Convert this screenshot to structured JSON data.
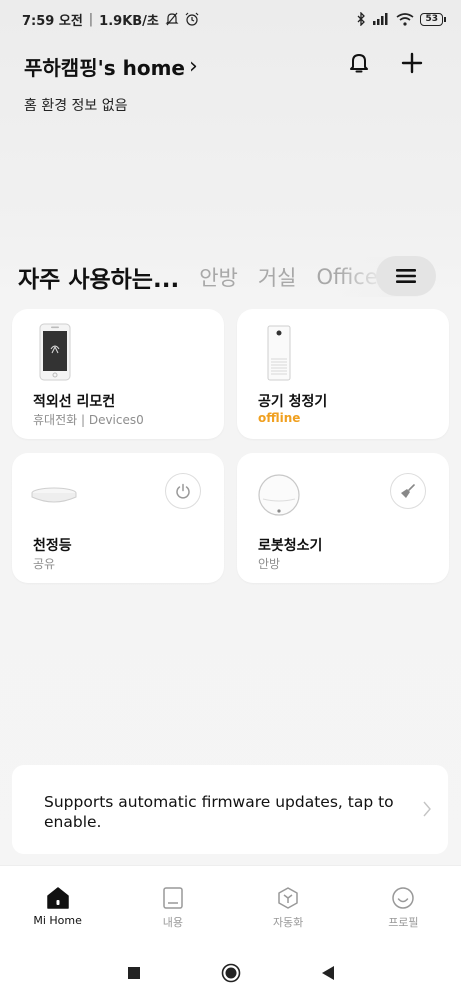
{
  "status": {
    "time": "7:59 오전",
    "network_speed": "1.9KB/초",
    "battery": "53"
  },
  "header": {
    "home_name": "푸하캠핑's home",
    "chevron": "›",
    "subtitle": "홈 환경 정보 없음"
  },
  "tabs": [
    {
      "label": "자주 사용하는...",
      "active": true
    },
    {
      "label": "안방",
      "active": false
    },
    {
      "label": "거실",
      "active": false
    },
    {
      "label": "Office",
      "active": false
    }
  ],
  "devices": [
    {
      "name": "적외선 리모컨",
      "sub": "휴대전화 | Devices0",
      "icon": "phone-remote-icon"
    },
    {
      "name": "공기 청정기",
      "sub": "offline",
      "icon": "air-purifier-icon",
      "status_color": "#f0a020"
    },
    {
      "name": "천정등",
      "sub": "공유",
      "icon": "ceiling-light-icon",
      "action": "power-icon"
    },
    {
      "name": "로봇청소기",
      "sub": "안방",
      "icon": "robot-vacuum-icon",
      "action": "broom-icon"
    }
  ],
  "firmware": {
    "text": "Supports automatic firmware updates, tap to enable."
  },
  "nav": [
    {
      "label": "Mi Home",
      "icon": "home-icon",
      "active": true
    },
    {
      "label": "내용",
      "icon": "content-icon",
      "active": false
    },
    {
      "label": "자동화",
      "icon": "automation-icon",
      "active": false
    },
    {
      "label": "프로필",
      "icon": "profile-icon",
      "active": false
    }
  ],
  "colors": {
    "accent_offline": "#f0a020",
    "background": "#f4f4f4",
    "card": "#ffffff"
  }
}
